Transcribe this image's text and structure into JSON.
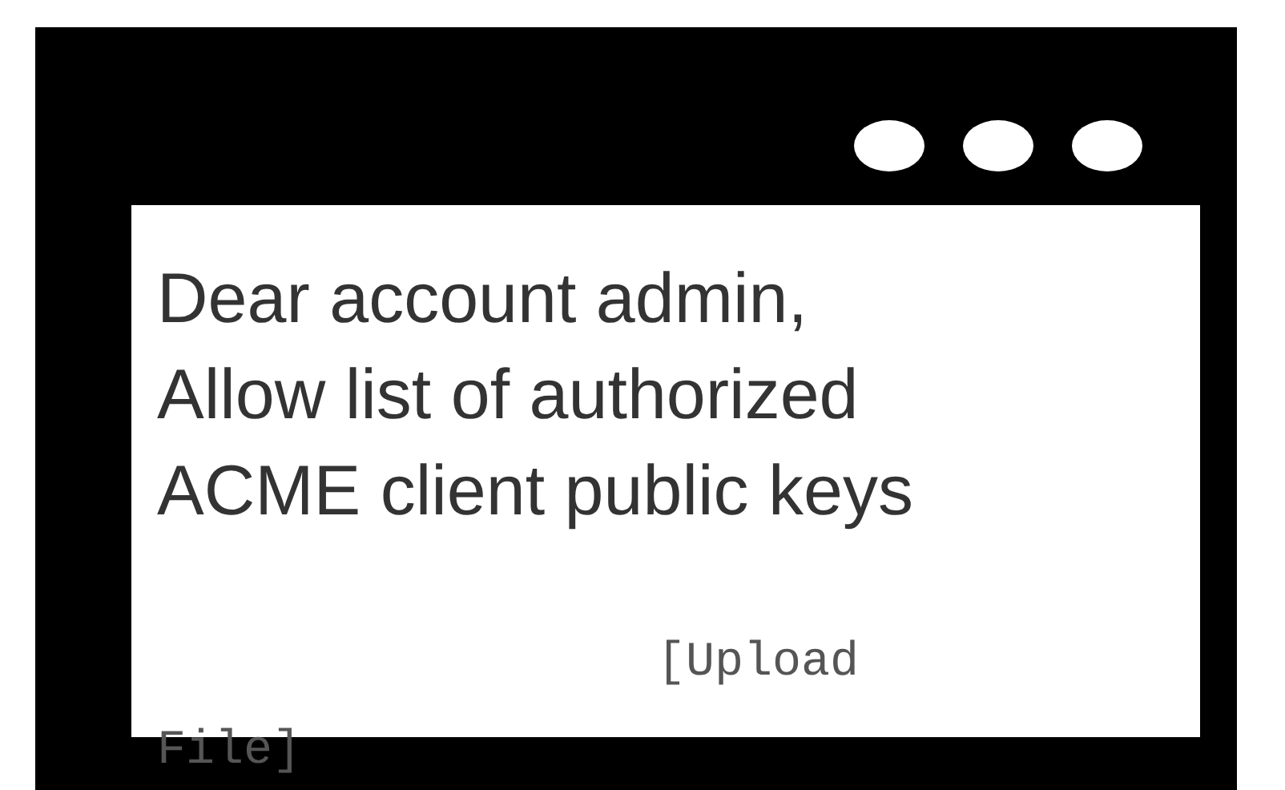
{
  "message": {
    "lines": [
      "Dear account admin,",
      "Allow list of authorized",
      "ACME client public keys"
    ],
    "upload_link": "[Upload File]"
  }
}
